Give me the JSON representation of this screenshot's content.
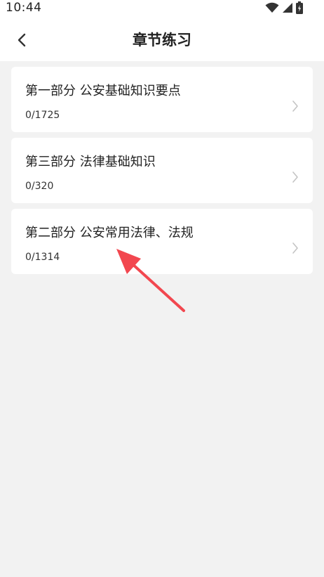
{
  "status_bar": {
    "time": "10:44",
    "icons": [
      "wifi-icon",
      "signal-icon",
      "battery-icon"
    ]
  },
  "header": {
    "title": "章节练习",
    "back_icon": "chevron-left-icon"
  },
  "chapters": [
    {
      "title": "第一部分 公安基础知识要点",
      "progress": "0/1725"
    },
    {
      "title": "第三部分 法律基础知识",
      "progress": "0/320"
    },
    {
      "title": "第二部分 公安常用法律、法规",
      "progress": "0/1314"
    }
  ],
  "colors": {
    "background": "#f2f2f2",
    "card": "#ffffff",
    "annotation_arrow": "#f2474f"
  }
}
